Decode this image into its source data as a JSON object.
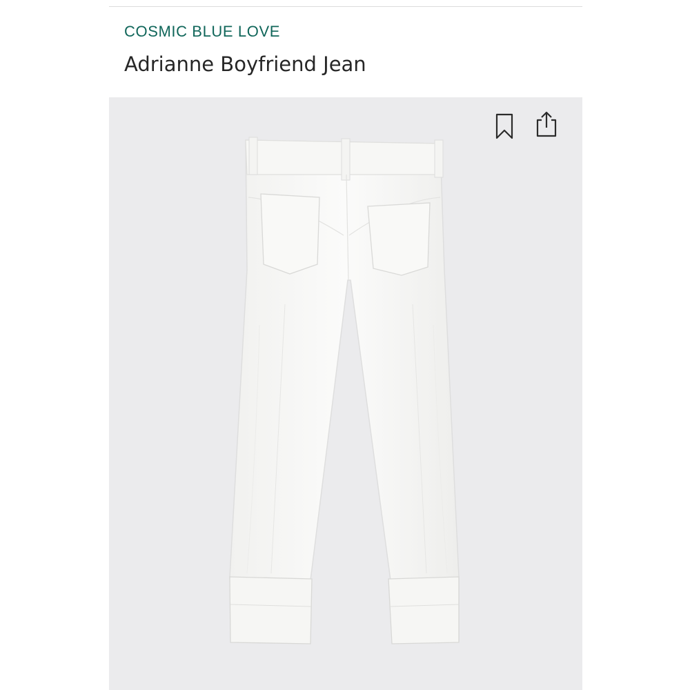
{
  "product": {
    "brand": "COSMIC BLUE LOVE",
    "title": "Adrianne Boyfriend Jean"
  },
  "actions": {
    "bookmark_icon": "bookmark-icon",
    "share_icon": "share-icon"
  },
  "colors": {
    "brand": "#10665a",
    "title": "#262626",
    "image_background": "#ebebed",
    "garment": "#f8f8f6"
  }
}
